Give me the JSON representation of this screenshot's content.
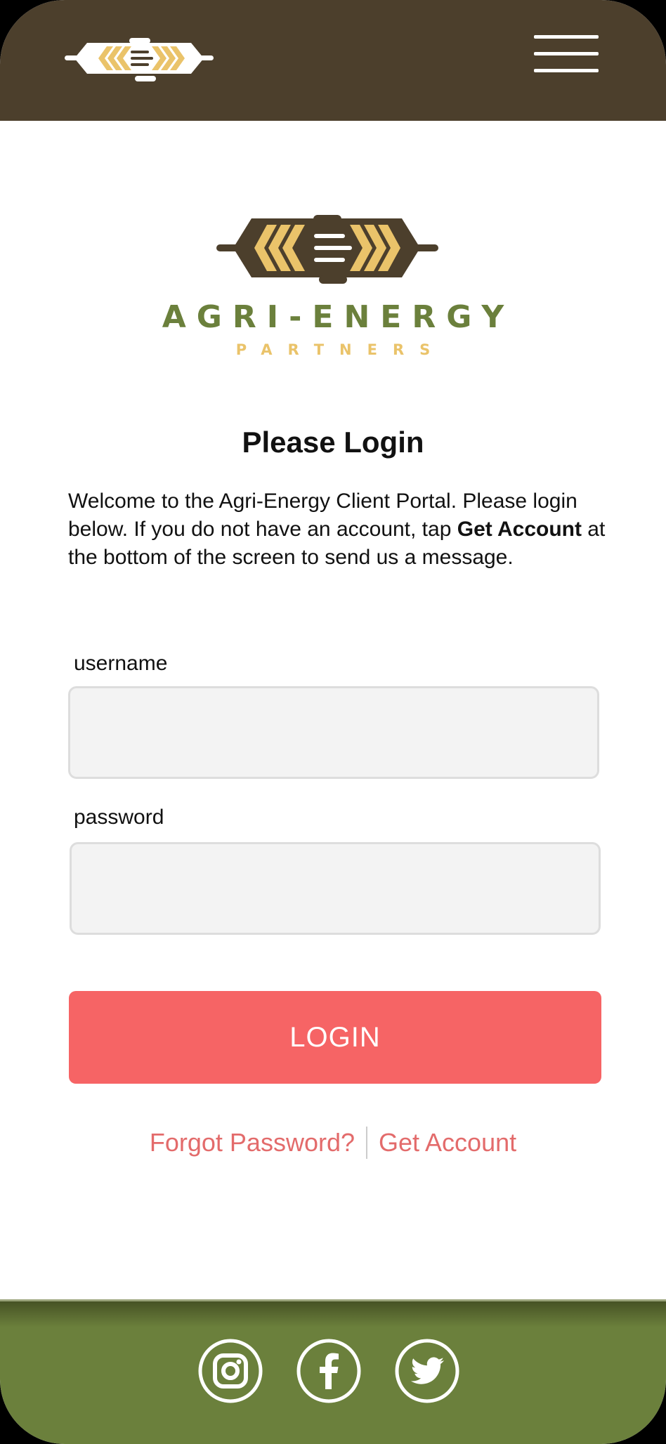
{
  "header": {
    "logo_icon": "wheat-chevron-logo-icon",
    "menu_icon": "hamburger-menu-icon"
  },
  "brand": {
    "name": "AGRI-ENERGY",
    "subtitle": "PARTNERS"
  },
  "login": {
    "title": "Please Login",
    "intro_before": "Welcome to the Agri-Energy Client Portal. Please login below. If you do not have an account, tap ",
    "intro_bold": "Get Account",
    "intro_after": " at the bottom of the screen to send us a message.",
    "username_label": "username",
    "username_value": "",
    "password_label": "password",
    "password_value": "",
    "button_label": "LOGIN"
  },
  "links": {
    "forgot_password": "Forgot Password?",
    "get_account": "Get Account"
  },
  "footer": {
    "social": [
      {
        "icon": "instagram-icon"
      },
      {
        "icon": "facebook-icon"
      },
      {
        "icon": "twitter-icon"
      }
    ]
  },
  "colors": {
    "header_bg": "#4c3f2c",
    "footer_bg": "#6b803c",
    "brand_green": "#6b803c",
    "brand_gold": "#eac36a",
    "accent_red": "#f66465",
    "link_red": "#e36b6b"
  }
}
